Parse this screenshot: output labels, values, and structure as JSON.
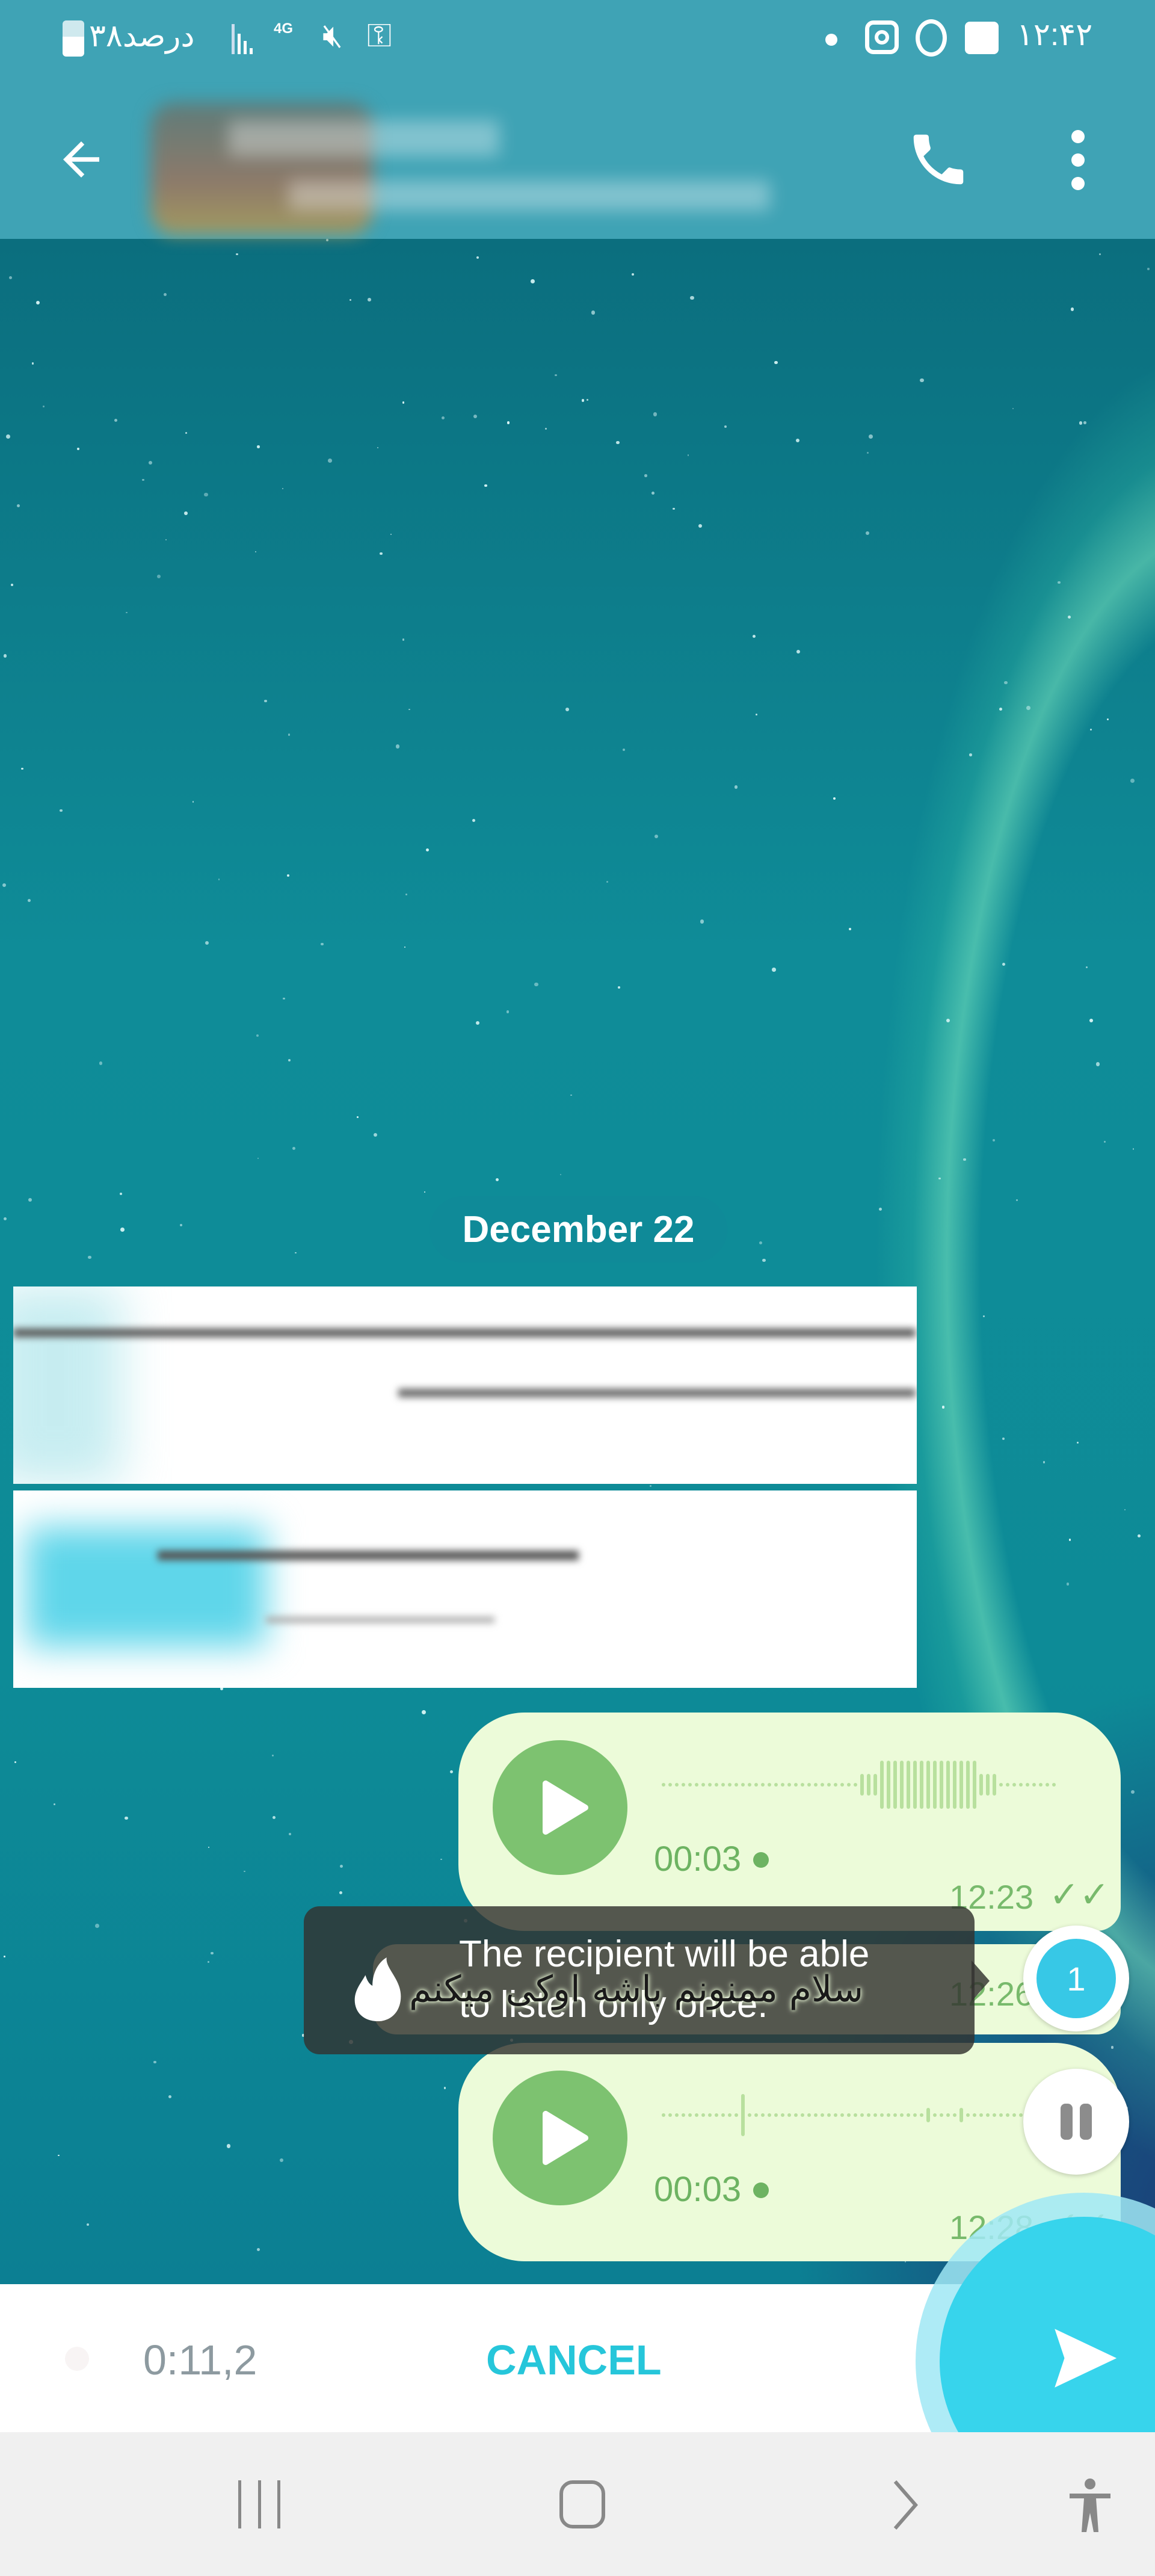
{
  "status_bar": {
    "time": "۱۲:۴۲",
    "battery": "۳۸درصد",
    "network": "4G",
    "icons": [
      "battery-icon",
      "signal-icon",
      "4g-icon",
      "mute-icon",
      "vpn-key-icon",
      "dot-icon",
      "instagram-icon",
      "threads-icon",
      "gallery-icon"
    ]
  },
  "header": {
    "back_icon": "arrow-left-icon",
    "call_icon": "phone-icon",
    "more_icon": "more-vertical-icon"
  },
  "chat": {
    "date_label": "December 22",
    "messages": [
      {
        "type": "voice",
        "duration": "00:03",
        "time": "12:23",
        "status": "read"
      },
      {
        "type": "text",
        "text": "سلام ممنونم باشه اوکی میکنم",
        "time": "12:26"
      },
      {
        "type": "voice",
        "duration": "00:03",
        "time": "12:28",
        "status": "read"
      }
    ]
  },
  "tooltip": {
    "icon": "fire-icon",
    "text_line1": "The recipient will be able",
    "text_line2": "to listen only once."
  },
  "view_once_badge": {
    "label": "1",
    "color": "#37c8e6"
  },
  "recording_bar": {
    "timer": "0:11,2",
    "cancel_label": "CANCEL",
    "accent": "#26c6da",
    "send_color": "#37d4ec"
  },
  "nav_bar": {
    "icons": [
      "recent-apps-icon",
      "home-icon",
      "back-icon",
      "accessibility-icon"
    ]
  }
}
